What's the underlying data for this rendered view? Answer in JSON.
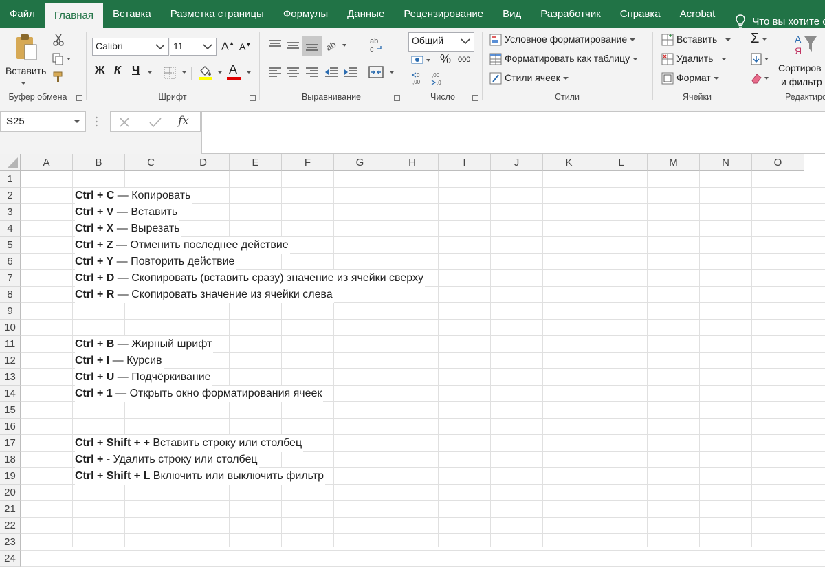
{
  "tabs": [
    {
      "label": "Файл",
      "active": false
    },
    {
      "label": "Главная",
      "active": true
    },
    {
      "label": "Вставка",
      "active": false
    },
    {
      "label": "Разметка страницы",
      "active": false
    },
    {
      "label": "Формулы",
      "active": false
    },
    {
      "label": "Данные",
      "active": false
    },
    {
      "label": "Рецензирование",
      "active": false
    },
    {
      "label": "Вид",
      "active": false
    },
    {
      "label": "Разработчик",
      "active": false
    },
    {
      "label": "Справка",
      "active": false
    },
    {
      "label": "Acrobat",
      "active": false
    }
  ],
  "tell_me": {
    "text": "Что вы хотите сделать",
    "icon": "lightbulb-icon"
  },
  "ribbon": {
    "clipboard": {
      "paste_label": "Вставить",
      "group_label": "Буфер обмена"
    },
    "font": {
      "font_name": "Calibri",
      "font_size": "11",
      "group_label": "Шрифт",
      "bold_label": "Ж",
      "italic_label": "К",
      "underline_label": "Ч",
      "grow_label": "A",
      "shrink_label": "A",
      "font_color_label": "A"
    },
    "alignment": {
      "group_label": "Выравнивание"
    },
    "number": {
      "format": "Общий",
      "percent": "%",
      "thousands": "000",
      "group_label": "Число"
    },
    "styles": {
      "conditional": "Условное форматирование",
      "as_table": "Форматировать как таблицу",
      "cell_styles": "Стили ячеек",
      "group_label": "Стили"
    },
    "cells": {
      "insert": "Вставить",
      "delete": "Удалить",
      "format": "Формат",
      "group_label": "Ячейки"
    },
    "editing": {
      "sort_line1": "Сортиров",
      "sort_line2": "и фильтр",
      "group_label": "Редактиро"
    }
  },
  "formula_bar": {
    "name_box": "S25",
    "fx": "fx",
    "content": ""
  },
  "colors": {
    "accent": "#217346",
    "ribbon_bg": "#f3f3f3",
    "font_red": "#e00000",
    "highlight_yellow": "#ffff00"
  },
  "columns": [
    "A",
    "B",
    "C",
    "D",
    "E",
    "F",
    "G",
    "H",
    "I",
    "J",
    "K",
    "L",
    "M",
    "N",
    "O"
  ],
  "rows": [
    "1",
    "2",
    "3",
    "4",
    "5",
    "6",
    "7",
    "8",
    "9",
    "10",
    "11",
    "12",
    "13",
    "14",
    "15",
    "16",
    "17",
    "18",
    "19",
    "20",
    "21",
    "22",
    "23",
    "24"
  ],
  "cells": [
    {
      "row": 2,
      "keys": "Ctrl + C",
      "desc": " — Копировать"
    },
    {
      "row": 3,
      "keys": "Ctrl + V",
      "desc": " — Вставить"
    },
    {
      "row": 4,
      "keys": "Ctrl + X",
      "desc": " — Вырезать"
    },
    {
      "row": 5,
      "keys": "Ctrl + Z",
      "desc": " — Отменить последнее действие"
    },
    {
      "row": 6,
      "keys": "Ctrl + Y",
      "desc": " — Повторить действие"
    },
    {
      "row": 7,
      "keys": "Ctrl + D",
      "desc": " — Скопировать (вставить сразу) значение из ячейки сверху"
    },
    {
      "row": 8,
      "keys": "Ctrl + R",
      "desc": " — Скопировать значение из ячейки слева"
    },
    {
      "row": 11,
      "keys": "Ctrl + B",
      "desc": " — Жирный шрифт"
    },
    {
      "row": 12,
      "keys": "Ctrl + I",
      "desc": " — Курсив"
    },
    {
      "row": 13,
      "keys": "Ctrl + U",
      "desc": " — Подчёркивание"
    },
    {
      "row": 14,
      "keys": "Ctrl + 1",
      "desc": " — Открыть окно форматирования ячеек"
    },
    {
      "row": 17,
      "keys": "Ctrl + Shift + +",
      "desc": " Вставить строку или столбец"
    },
    {
      "row": 18,
      "keys": "Ctrl + -",
      "desc": " Удалить строку или столбец"
    },
    {
      "row": 19,
      "keys": "Ctrl + Shift + L",
      "desc": " Включить или выключить фильтр"
    }
  ]
}
